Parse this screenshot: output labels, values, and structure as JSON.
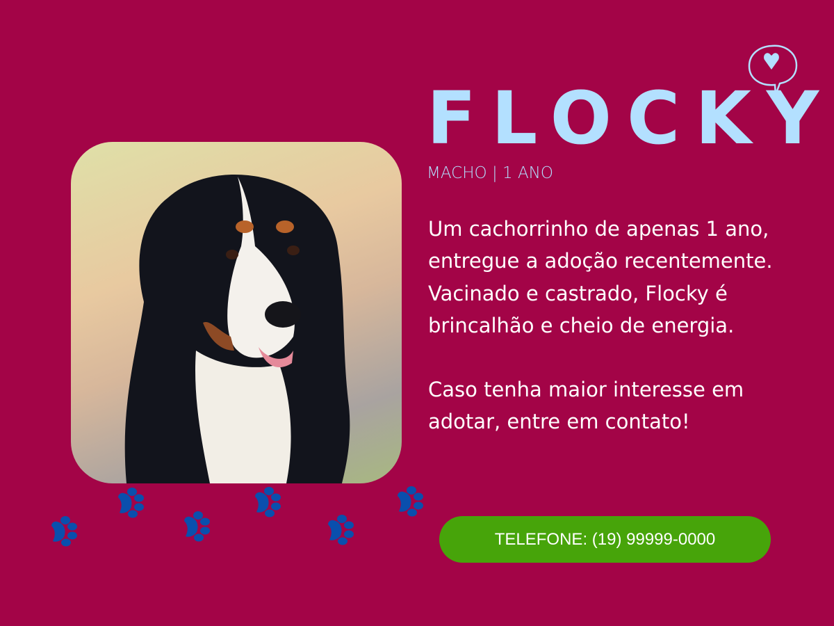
{
  "name": "FLOCKY",
  "subtitle": "MACHO | 1 ANO",
  "description": {
    "line1": "Um cachorrinho de apenas 1 ano, entregue a adoção recentemente.",
    "line2": "Vacinado e castrado, Flocky é brincalhão e cheio de energia.",
    "line3": "Caso tenha maior interesse em adotar, entre em contato!"
  },
  "phone_button": "TELEFONE: (19) 99999-0000",
  "colors": {
    "background": "#a30447",
    "title": "#b3e0ff",
    "button": "#47a40a",
    "paw": "#0a4fad"
  }
}
